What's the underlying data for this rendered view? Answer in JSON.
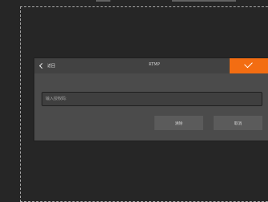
{
  "dialog": {
    "back_label": "返回",
    "title": "RTMP",
    "input_placeholder": "输入授权码:",
    "input_value": "",
    "clear_label": "清除",
    "cancel_label": "取消",
    "confirm_icon": "check-icon",
    "back_icon": "chevron-left-icon"
  },
  "colors": {
    "background": "#262626",
    "panel": "#4b4b4b",
    "header": "#424242",
    "accent": "#f36d12",
    "button": "#5b5b5b",
    "dashed_border": "#a7a7a7"
  }
}
